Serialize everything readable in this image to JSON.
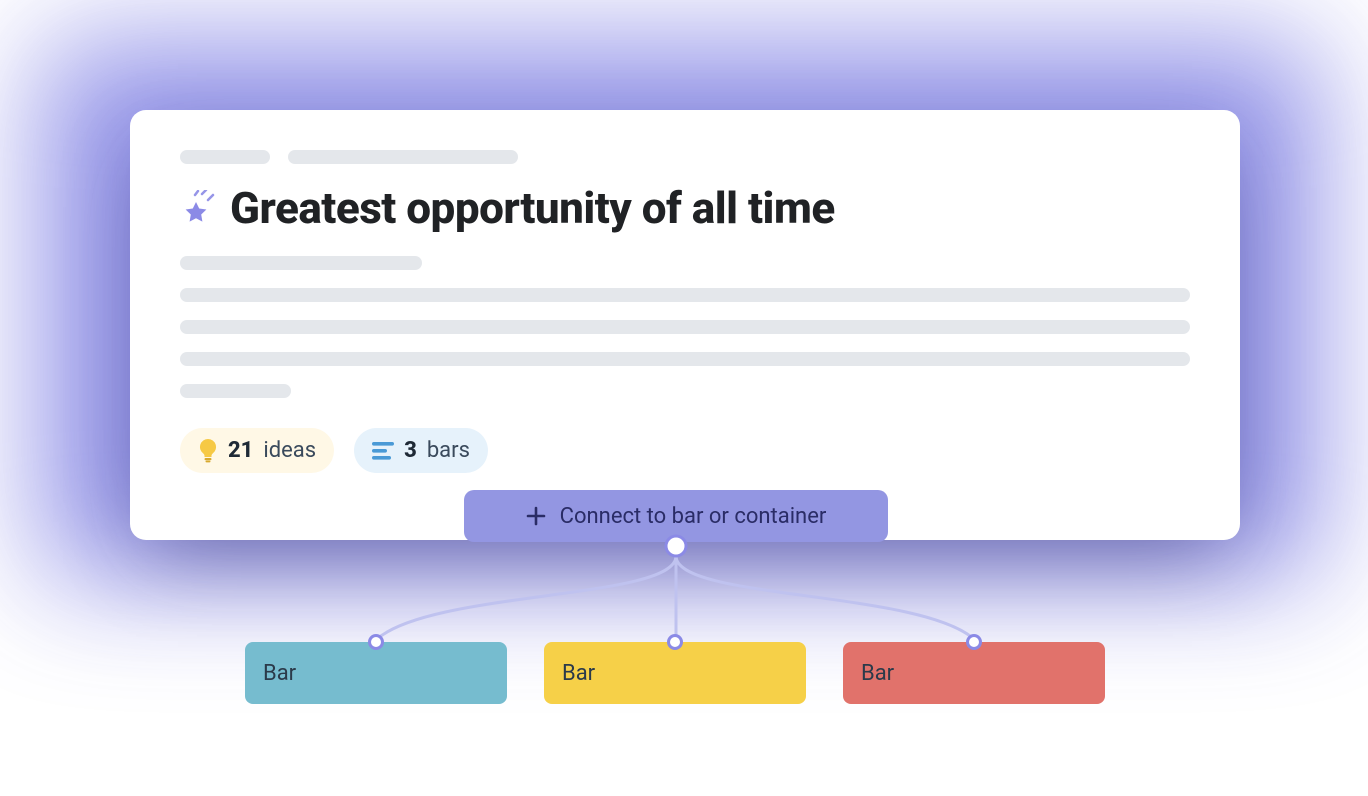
{
  "card": {
    "title": "Greatest opportunity of all time"
  },
  "chips": {
    "ideas": {
      "count": "21",
      "label": "ideas"
    },
    "bars": {
      "count": "3",
      "label": "bars"
    }
  },
  "connect": {
    "label": "Connect to bar or container"
  },
  "bars": [
    {
      "label": "Bar",
      "color": "blue"
    },
    {
      "label": "Bar",
      "color": "yellow"
    },
    {
      "label": "Bar",
      "color": "red"
    }
  ]
}
